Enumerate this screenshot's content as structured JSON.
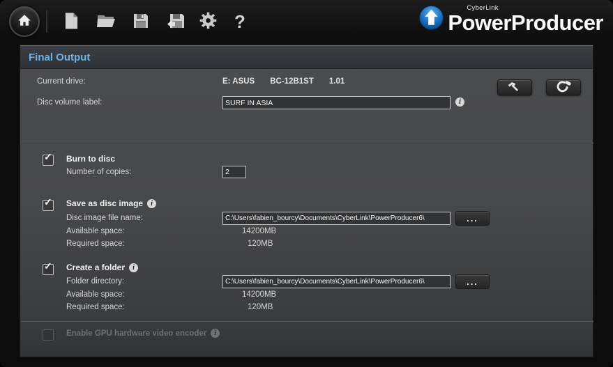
{
  "brand": {
    "small": "CyberLink",
    "large": "PowerProducer"
  },
  "ui": {
    "check_glyph": "✓",
    "browse_label": "...",
    "info_glyph": "i",
    "help_glyph": "?"
  },
  "toolbar": {
    "icons": [
      "home-icon",
      "new-project-icon",
      "open-project-icon",
      "save-project-icon",
      "save-project-as-icon",
      "settings-gear-icon",
      "help-icon"
    ],
    "actions": [
      "burner-tools-icon",
      "erase-disc-icon"
    ]
  },
  "panel": {
    "title": "Final Output",
    "current_drive": {
      "label": "Current drive:",
      "drive": "E: ASUS",
      "model": "BC-12B1ST",
      "firmware": "1.01"
    },
    "volume_label": {
      "label": "Disc volume label:",
      "value": "SURF IN ASIA"
    },
    "burn_to_disc": {
      "title": "Burn to disc",
      "checked": true,
      "copies_label": "Number of copies:",
      "copies_value": "2"
    },
    "save_as_disc_image": {
      "title": "Save as disc image",
      "checked": true,
      "file_name_label": "Disc image file name:",
      "file_path": "C:\\Users\\fabien_bourcy\\Documents\\CyberLink\\PowerProducer6\\",
      "available_space_label": "Available space:",
      "available_space_value": "14200MB",
      "required_space_label": "Required space:",
      "required_space_value": "120MB"
    },
    "create_a_folder": {
      "title": "Create a folder",
      "checked": true,
      "directory_label": "Folder directory:",
      "directory_path": "C:\\Users\\fabien_bourcy\\Documents\\CyberLink\\PowerProducer6\\",
      "available_space_label": "Available space:",
      "available_space_value": "14200MB",
      "required_space_label": "Required space:",
      "required_space_value": "120MB"
    },
    "gpu": {
      "label": "Enable GPU hardware video encoder",
      "checked": false,
      "enabled": false
    }
  },
  "colors": {
    "accent_title": "#6db1e6",
    "logo_blue": "#1f72c4",
    "panel_bg": "#47484a",
    "toolbar_icon": "#c9c9c9"
  }
}
